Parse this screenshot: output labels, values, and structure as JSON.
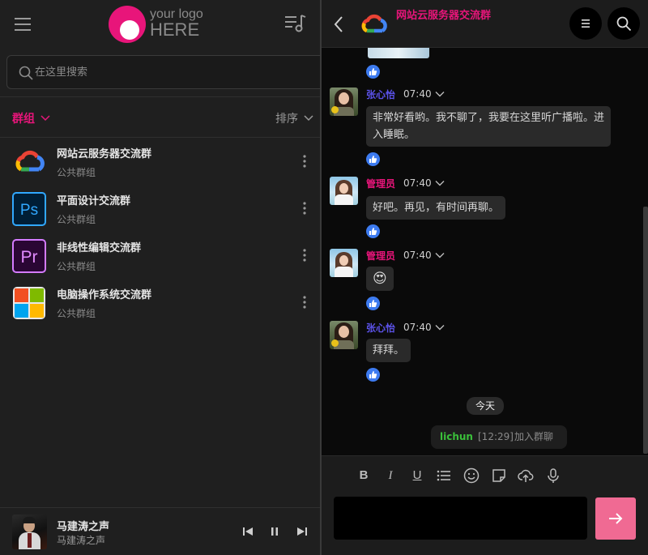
{
  "app": {
    "logo_line1": "your logo",
    "logo_line2": "HERE",
    "brand_color": "#e8157a"
  },
  "search": {
    "placeholder": "在这里搜索",
    "value": ""
  },
  "filters": {
    "group_label": "群组",
    "sort_label": "排序"
  },
  "groups": [
    {
      "name": "网站云服务器交流群",
      "type": "公共群组",
      "icon": "google-cloud-icon"
    },
    {
      "name": "平面设计交流群",
      "type": "公共群组",
      "icon": "photoshop-icon"
    },
    {
      "name": "非线性编辑交流群",
      "type": "公共群组",
      "icon": "premiere-icon"
    },
    {
      "name": "电脑操作系统交流群",
      "type": "公共群组",
      "icon": "windows-icon"
    }
  ],
  "player": {
    "title": "马建涛之声",
    "artist": "马建涛之声"
  },
  "chat": {
    "title": "网站云服务器交流群",
    "messages": [
      {
        "author": "张心怡",
        "time": "07:40",
        "text": "非常好看哟。我不聊了，我要在这里听广播啦。进入睡眠。"
      },
      {
        "author": "管理员",
        "time": "07:40",
        "text": "好吧。再见，有时间再聊。"
      },
      {
        "author": "管理员",
        "time": "07:40",
        "text": "😍"
      },
      {
        "author": "张心怡",
        "time": "07:40",
        "text": "拜拜。"
      }
    ],
    "day_separator": "今天",
    "join_notice": {
      "user": "lichun",
      "time": "[12:29]",
      "text": "加入群聊"
    }
  },
  "composer": {
    "bold": "B",
    "italic": "I",
    "underline": "U",
    "placeholder": ""
  }
}
